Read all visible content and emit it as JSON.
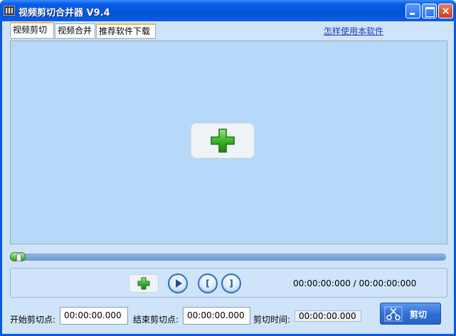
{
  "window": {
    "title": "视频剪切合并器 V9.4",
    "controls": {
      "minimize": "",
      "maximize": "",
      "close": "×"
    }
  },
  "tabs": [
    {
      "label": "视频剪切",
      "active": true
    },
    {
      "label": "视频合并",
      "active": false
    },
    {
      "label": "推荐软件下载",
      "active": false
    }
  ],
  "help_link": "怎样使用本软件",
  "preview": {
    "add_icon": "plus-icon"
  },
  "timeline": {
    "position_fraction": 0.0
  },
  "controls": {
    "add_icon": "plus-icon",
    "play_icon": "play-icon",
    "mark_in": "[",
    "mark_out": "]",
    "time_display": "00:00:00:000 / 00:00:00:000"
  },
  "bottom": {
    "start_label": "开始剪切点:",
    "start_value": "00:00:00.000",
    "end_label": "结束剪切点:",
    "end_value": "00:00:00.000",
    "duration_label": "剪切时间:",
    "duration_value": "00:00:00.000",
    "cut_button_label": "剪切"
  },
  "colors": {
    "title_bar": "#0653d8",
    "client_bg": "#cfe4fb",
    "preview_bg": "#b6d9f9",
    "accent_green": "#3fb52c",
    "link": "#1a3fb8"
  }
}
